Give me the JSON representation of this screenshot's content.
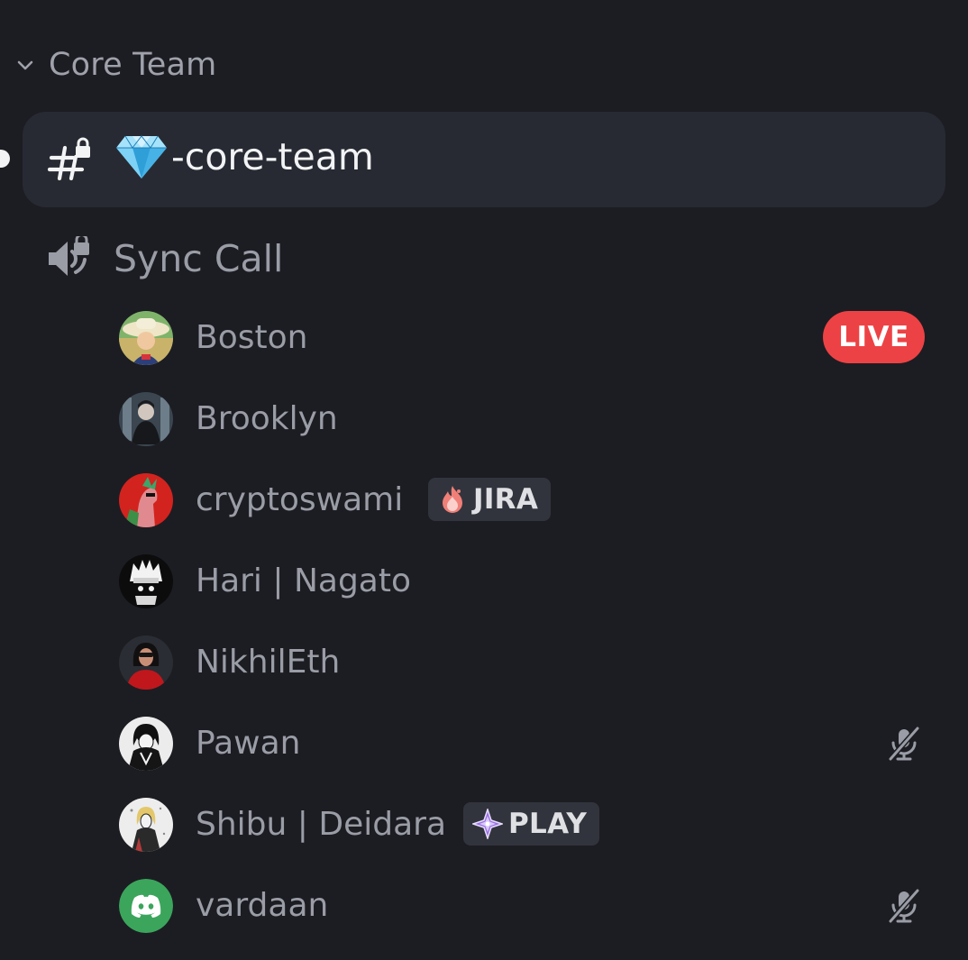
{
  "category": {
    "label": "Core Team",
    "icon": "chevron-down-icon"
  },
  "text_channel": {
    "name": "-core-team",
    "icon": "locked-hash-icon",
    "emoji": "gem-emoji",
    "selected": true,
    "unread": true
  },
  "voice_channel": {
    "name": "Sync Call",
    "icon": "locked-speaker-icon"
  },
  "voice_users": [
    {
      "name": "Boston",
      "badge": "LIVE",
      "avatar_color": "#e8c873"
    },
    {
      "name": "Brooklyn",
      "avatar_color": "#5a6a78"
    },
    {
      "name": "cryptoswami",
      "activity": "JIRA",
      "avatar_color": "#d3231f"
    },
    {
      "name": "Hari | Nagato",
      "avatar_color": "#111111"
    },
    {
      "name": "NikhilEth",
      "avatar_color": "#c0171c"
    },
    {
      "name": "Pawan",
      "muted": true,
      "avatar_color": "#e9e9e9"
    },
    {
      "name": "Shibu | Deidara",
      "activity": "PLAY",
      "avatar_color": "#ededed"
    },
    {
      "name": "vardaan",
      "muted": true,
      "avatar_color": "#3ba55c"
    }
  ],
  "colors": {
    "background": "#1c1d22",
    "selected_channel": "#282a33",
    "live_badge": "#ed4245",
    "muted_text": "#9a9ca6",
    "active_text": "#f2f3f5"
  }
}
